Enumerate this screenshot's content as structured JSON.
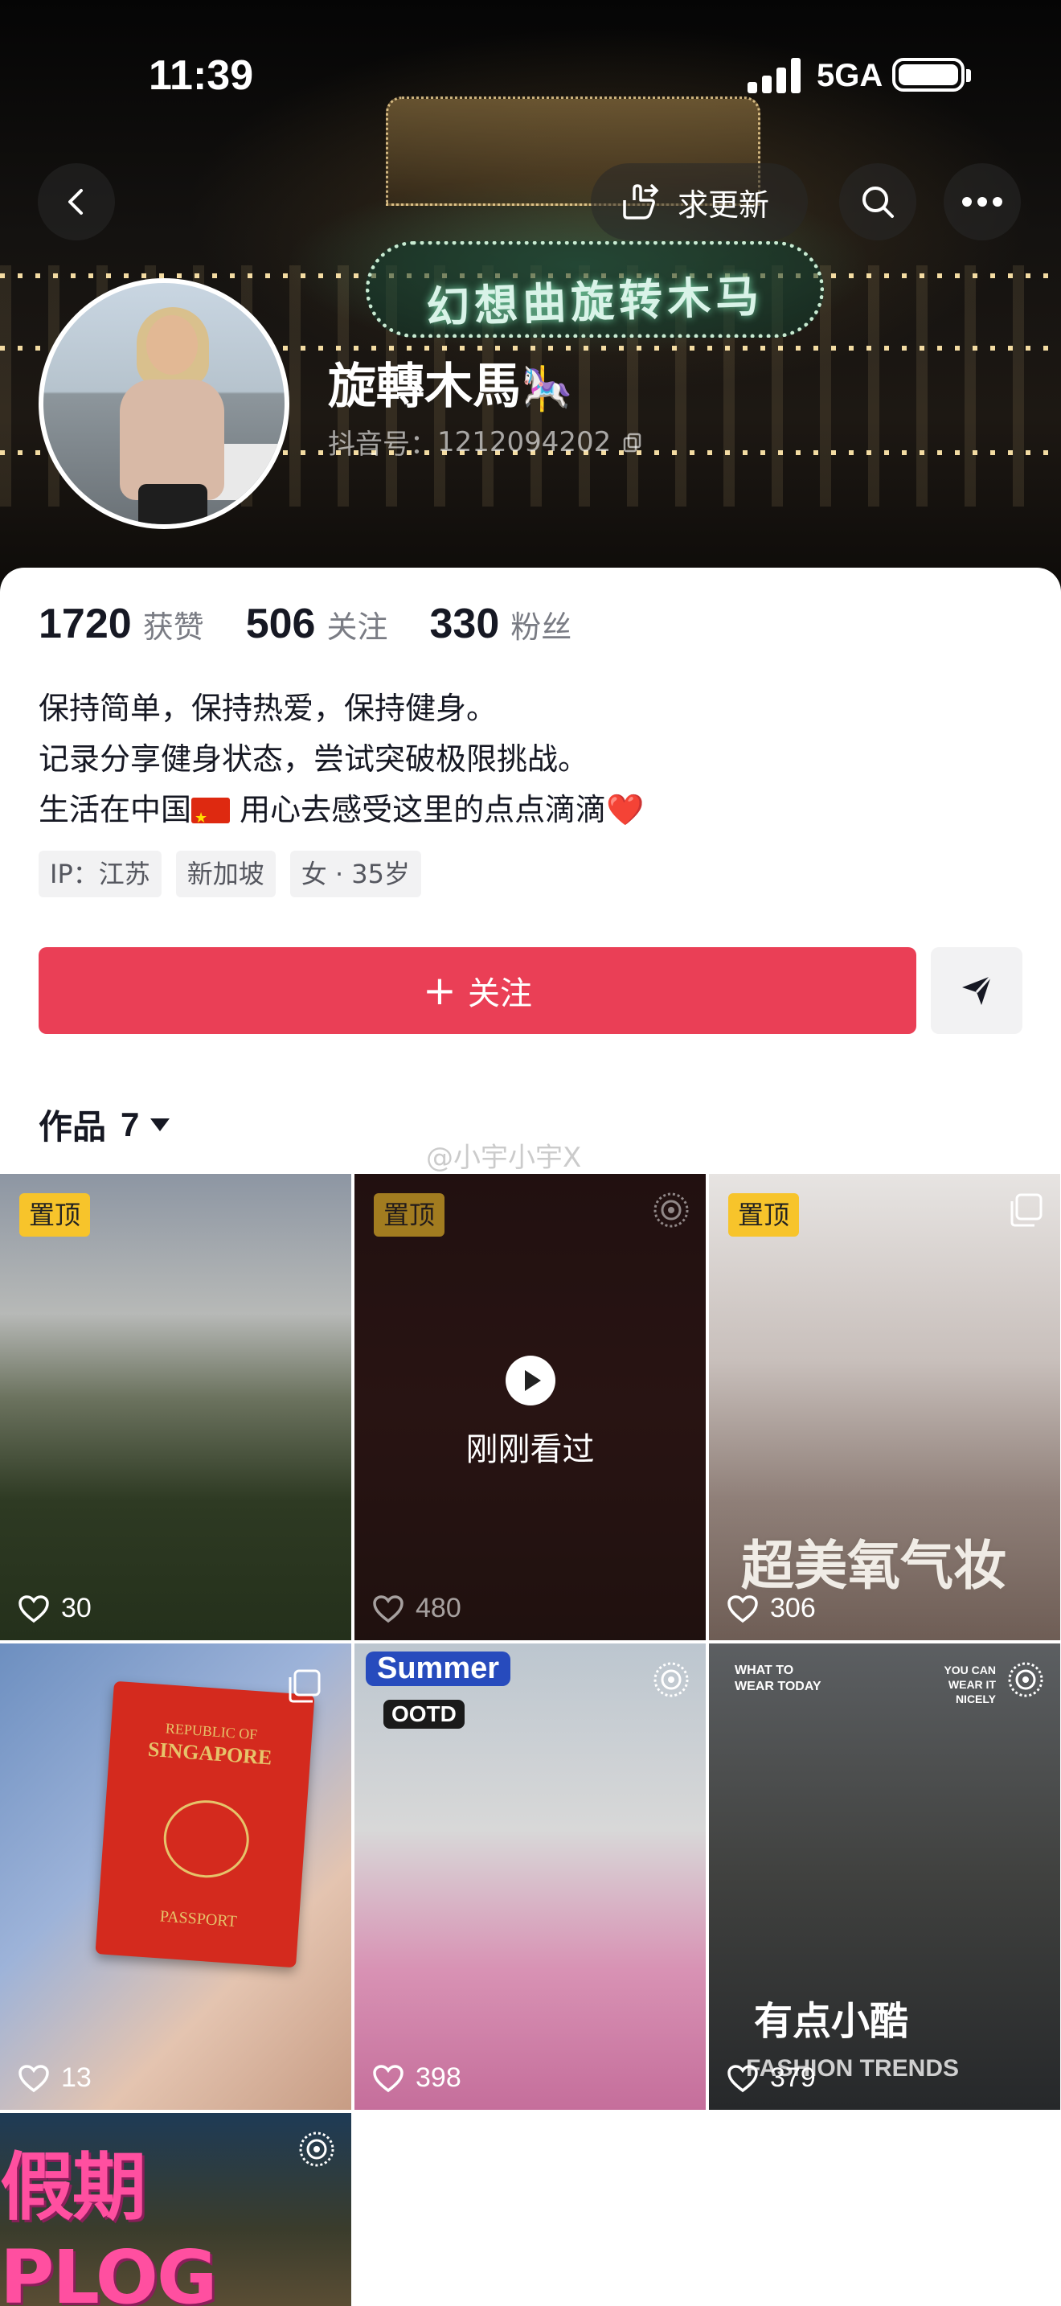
{
  "status_bar": {
    "time": "11:39",
    "network": "5GA"
  },
  "header": {
    "back_icon": "chevron-left-icon",
    "update_label": "求更新",
    "search_icon": "search-icon",
    "more_icon": "more-dots-icon",
    "cover_sign_text": "幻想曲旋转木马"
  },
  "profile": {
    "display_name": "旋轉木馬",
    "name_emoji": "🎠",
    "douyin_id_label": "抖音号：",
    "douyin_id": "1212094202",
    "stats": [
      {
        "value": "1720",
        "label": "获赞"
      },
      {
        "value": "506",
        "label": "关注"
      },
      {
        "value": "330",
        "label": "粉丝"
      }
    ],
    "bio": [
      "保持简单，保持热爱，保持健身。",
      "记录分享健身状态，尝试突破极限挑战。"
    ],
    "bio_line3_a": "生活在中国",
    "bio_line3_b": " 用心去感受这里的点点滴滴",
    "bio_heart": "❤️",
    "tags": [
      "IP：江苏",
      "新加坡",
      "女 · 35岁"
    ]
  },
  "actions": {
    "follow_plus": "+",
    "follow_label": "关注"
  },
  "works": {
    "label": "作品",
    "count": "7"
  },
  "watermark": "@小宇小宇X",
  "videos": [
    {
      "pinned": "置顶",
      "likes": "30"
    },
    {
      "pinned": "置顶",
      "likes": "480",
      "recent": "刚刚看过"
    },
    {
      "pinned": "置顶",
      "likes": "306",
      "overlay": "超美氧气妆"
    },
    {
      "likes": "13",
      "passport_top": "REPUBLIC OF",
      "passport_country": "SINGAPORE",
      "passport_bottom": "PASSPORT"
    },
    {
      "likes": "398",
      "badge1": "Summer",
      "badge2": "OOTD"
    },
    {
      "likes": "379",
      "top_left": "WHAT TO WEAR TODAY",
      "top_right": "YOU CAN WEAR IT NICELY",
      "overlay": "有点小酷",
      "sub": "FASHION TRENDS"
    },
    {
      "overlay": "假期PLOG"
    }
  ]
}
